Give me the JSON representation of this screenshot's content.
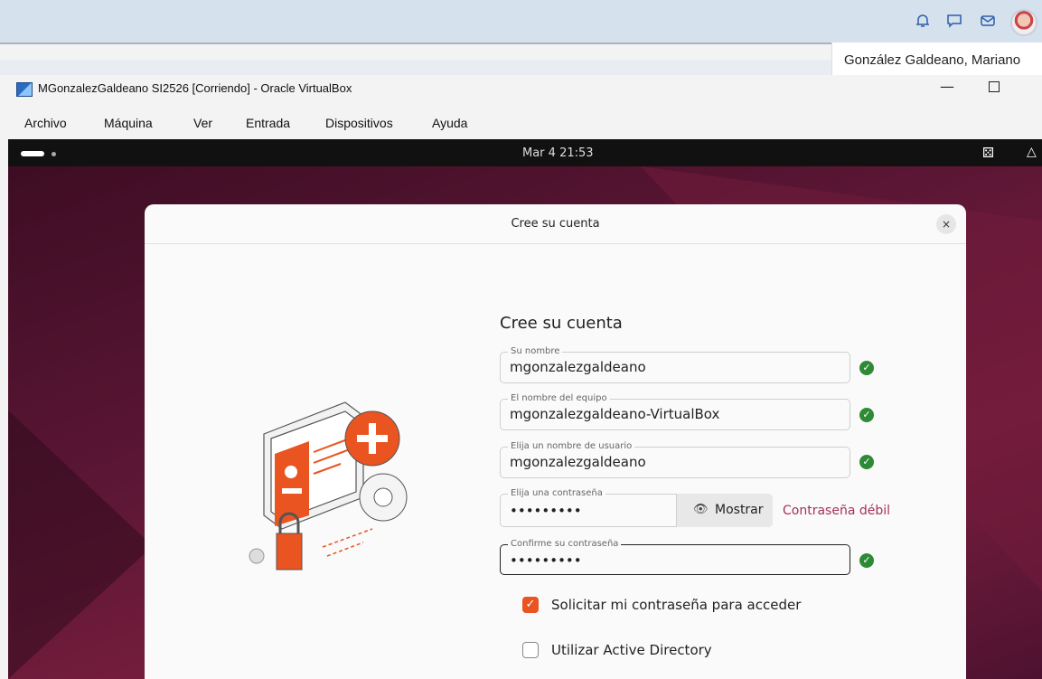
{
  "host": {
    "username": "González Galdeano, Mariano",
    "icons": [
      "bell-icon",
      "chat-icon",
      "mail-icon"
    ]
  },
  "vbox": {
    "title": "MGonzalezGaldeano SI2526 [Corriendo] - Oracle VirtualBox",
    "menu": [
      "Archivo",
      "Máquina",
      "Ver",
      "Entrada",
      "Dispositivos",
      "Ayuda"
    ],
    "minimize": "—"
  },
  "guest": {
    "clock": "Mar 4  21:53"
  },
  "dialog": {
    "title": "Cree su cuenta",
    "close": "×",
    "heading": "Cree su cuenta",
    "fields": [
      {
        "label": "Su nombre",
        "value": "mgonzalezgaldeano"
      },
      {
        "label": "El nombre del equipo",
        "value": "mgonzalezgaldeano-VirtualBox"
      },
      {
        "label": "Elija un nombre de usuario",
        "value": "mgonzalezgaldeano"
      },
      {
        "label": "Elija una contraseña",
        "value": "•••••••••"
      },
      {
        "label": "Confirme su contraseña",
        "value": "•••••••••"
      }
    ],
    "show_button": "Mostrar",
    "strength": "Contraseña débil",
    "options": [
      {
        "label": "Solicitar mi contraseña para acceder",
        "checked": true
      },
      {
        "label": "Utilizar Active Directory",
        "checked": false
      }
    ]
  },
  "colors": {
    "accent": "#e95420",
    "ok": "#2e8a34",
    "weak": "#a4305a"
  }
}
